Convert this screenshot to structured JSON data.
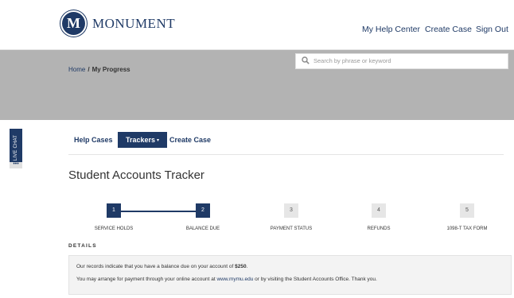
{
  "header": {
    "logo_letter": "M",
    "brand": "MONUMENT",
    "nav": {
      "help_center": "My Help Center",
      "create_case": "Create Case",
      "sign_out": "Sign Out"
    }
  },
  "banner": {
    "breadcrumb": {
      "home": "Home",
      "separator": "/",
      "current": "My Progress"
    },
    "search": {
      "placeholder": "Search by phrase or keyword",
      "icon": "search-icon"
    }
  },
  "live_chat": {
    "label": "LIVE CHAT",
    "dots": "•••"
  },
  "tabs": {
    "help_cases": "Help Cases",
    "trackers": "Trackers",
    "trackers_caret": "▾",
    "create_case": "Create Case"
  },
  "page": {
    "title": "Student Accounts Tracker"
  },
  "steps": [
    {
      "number": "1",
      "label": "SERVICE HOLDS",
      "state": "active"
    },
    {
      "number": "2",
      "label": "BALANCE DUE",
      "state": "active"
    },
    {
      "number": "3",
      "label": "PAYMENT STATUS",
      "state": "inactive"
    },
    {
      "number": "4",
      "label": "REFUNDS",
      "state": "inactive"
    },
    {
      "number": "5",
      "label": "1098-T TAX FORM",
      "state": "inactive"
    }
  ],
  "details": {
    "heading": "DETAILS",
    "line1_prefix": "Our records indicate that you have a balance due on your account of ",
    "amount": "$250",
    "line1_suffix": ".",
    "line2_prefix": "You may arrange for payment through your online account at ",
    "link": "www.mymu.edu",
    "line2_suffix": " or by visiting the Student Accounts Office.  Thank you."
  },
  "colors": {
    "brand": "#1f3a66",
    "banner": "#b3b3b3",
    "inactive_step": "#e6e6e6"
  }
}
